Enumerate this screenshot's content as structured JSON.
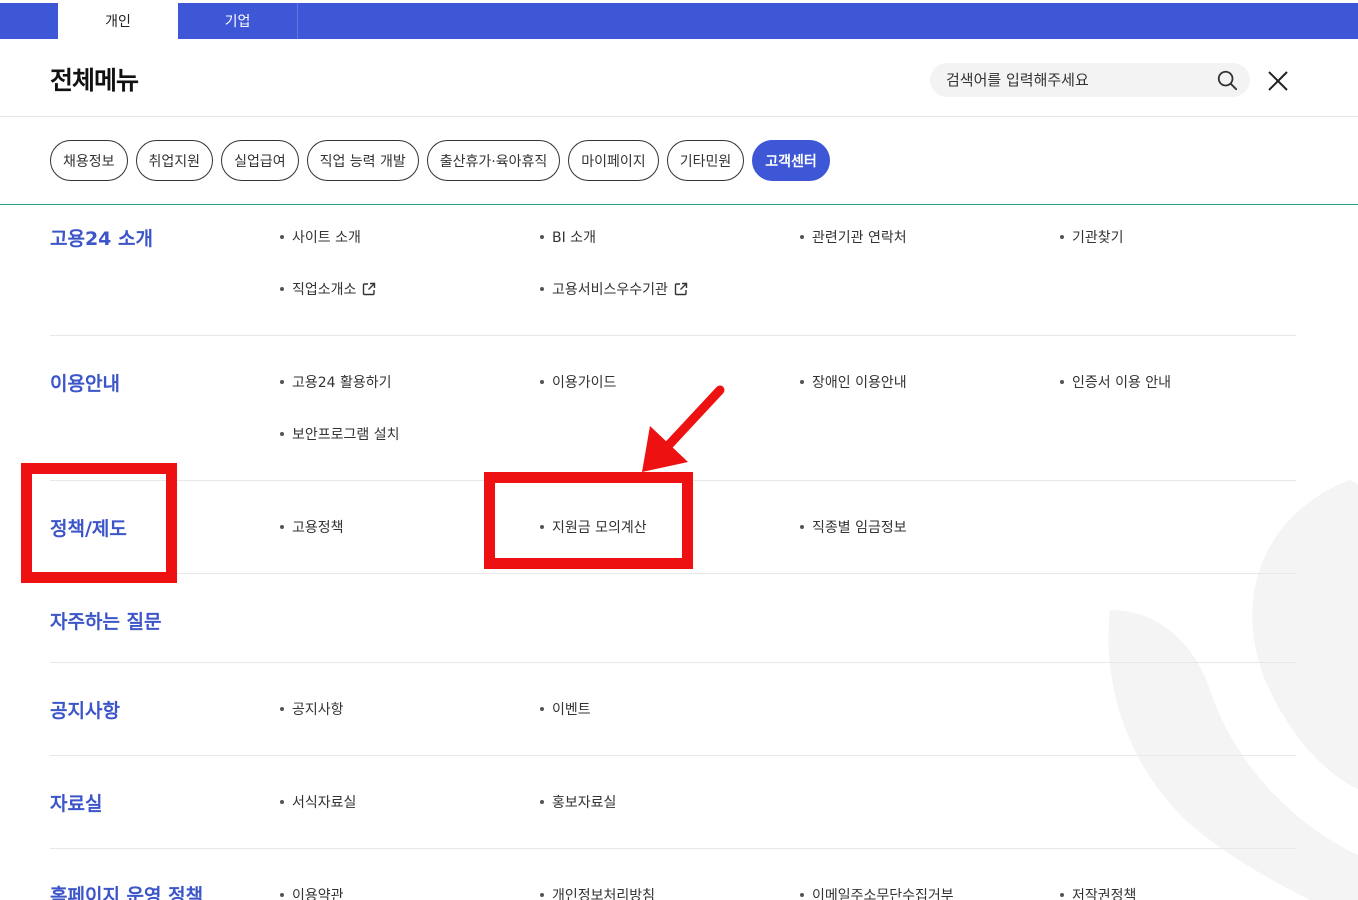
{
  "top_tabs": [
    "개인",
    "기업"
  ],
  "header": {
    "title": "전체메뉴",
    "search_placeholder": "검색어를 입력해주세요"
  },
  "categories": [
    "채용정보",
    "취업지원",
    "실업급여",
    "직업 능력 개발",
    "출산휴가·육아휴직",
    "마이페이지",
    "기타민원",
    "고객센터"
  ],
  "active_category": "고객센터",
  "sections": [
    {
      "title": "고용24 소개",
      "items": [
        "사이트 소개",
        "BI 소개",
        "관련기관 연락처",
        "기관찾기",
        "직업소개소",
        "고용서비스우수기관"
      ]
    },
    {
      "title": "이용안내",
      "items": [
        "고용24 활용하기",
        "이용가이드",
        "장애인 이용안내",
        "인증서 이용 안내",
        "보안프로그램 설치"
      ]
    },
    {
      "title": "정책/제도",
      "items": [
        "고용정책",
        "지원금 모의계산",
        "직종별 임금정보"
      ]
    },
    {
      "title": "자주하는 질문",
      "items": []
    },
    {
      "title": "공지사항",
      "items": [
        "공지사항",
        "이벤트"
      ]
    },
    {
      "title": "자료실",
      "items": [
        "서식자료실",
        "홍보자료실"
      ]
    },
    {
      "title": "홈페이지 운영 정책",
      "items": [
        "이용약관",
        "개인정보처리방침",
        "이메일주소무단수집거부",
        "저작권정책"
      ]
    }
  ],
  "colors": {
    "brand_blue": "#3d57d6",
    "title_blue": "#3c55c8",
    "annotation_red": "#ee1111"
  }
}
